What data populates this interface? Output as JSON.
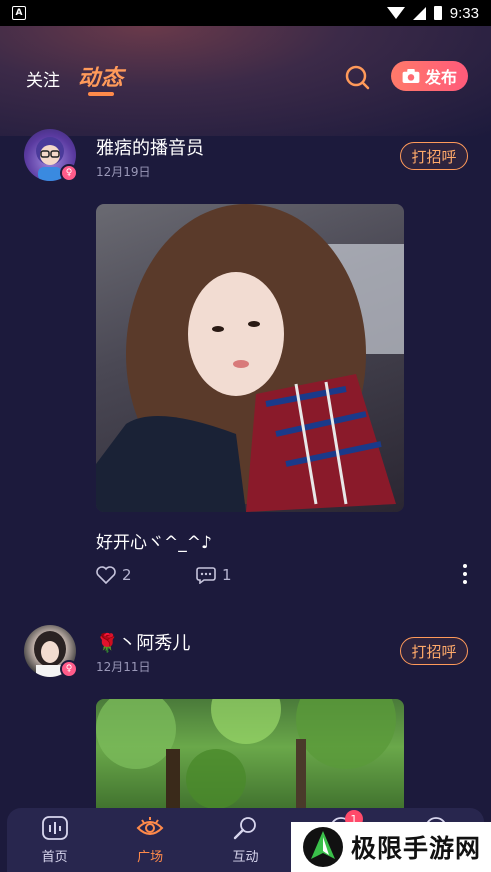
{
  "statusbar": {
    "time": "9:33",
    "app_icon": "A"
  },
  "header": {
    "tab_follow": "关注",
    "tab_dongtai": "动态",
    "publish_label": "发布"
  },
  "posts": [
    {
      "username": "雅痞的播音员",
      "date": "12月19日",
      "greet_label": "打招呼",
      "text": "好开心ヾ^_^♪",
      "likes": "2",
      "comments": "1"
    },
    {
      "username": "🌹丶阿秀儿",
      "date": "12月11日",
      "greet_label": "打招呼"
    }
  ],
  "nav": {
    "items": [
      {
        "label": "首页",
        "icon": "audio-wave-icon"
      },
      {
        "label": "广场",
        "icon": "eye-icon"
      },
      {
        "label": "互动",
        "icon": "microphone-icon"
      },
      {
        "label": "",
        "icon": "message-icon",
        "badge": "1"
      },
      {
        "label": "",
        "icon": "profile-icon"
      }
    ]
  },
  "watermark": {
    "text": "极限手游网"
  },
  "colors": {
    "accent": "#ff8a4a",
    "background": "#1c1a3c",
    "greet_border": "#ff9a5a"
  }
}
